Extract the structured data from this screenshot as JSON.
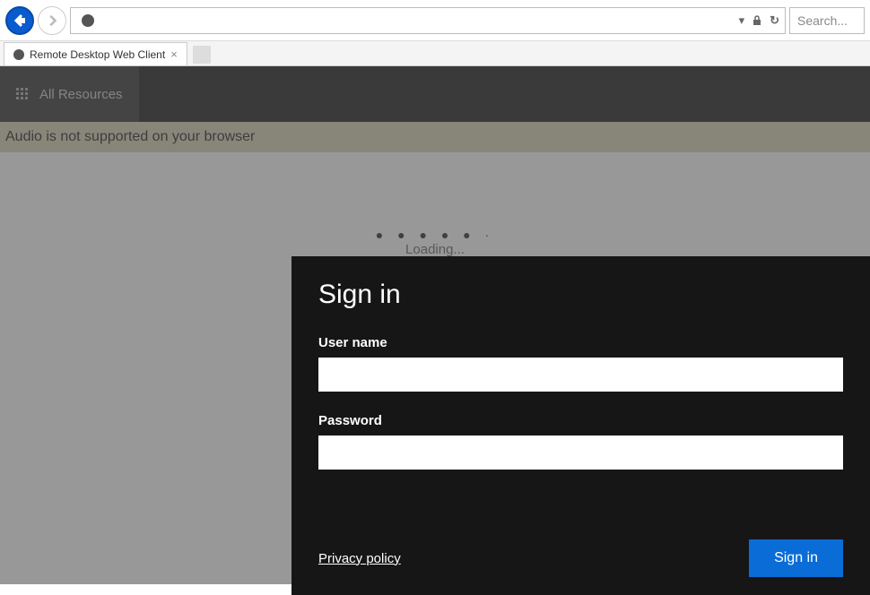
{
  "browser": {
    "address": "",
    "search_placeholder": "Search...",
    "tab_title": "Remote Desktop Web Client",
    "address_caret": "▾"
  },
  "app_header": {
    "nav_label": "All Resources"
  },
  "banner": {
    "text": "Audio is not supported on your browser"
  },
  "loading": {
    "text": "Loading..."
  },
  "signin": {
    "title": "Sign in",
    "username_label": "User name",
    "username_value": "",
    "password_label": "Password",
    "password_value": "",
    "privacy_link": "Privacy policy",
    "button_label": "Sign in"
  }
}
